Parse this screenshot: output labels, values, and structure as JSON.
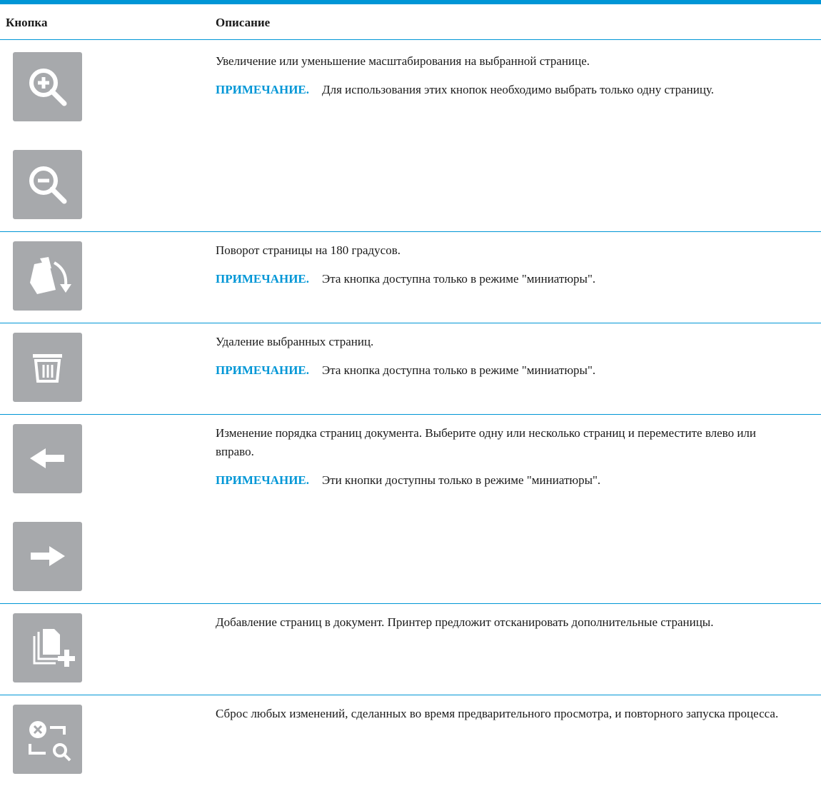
{
  "header": {
    "col_button": "Кнопка",
    "col_description": "Описание"
  },
  "colors": {
    "accent": "#0096d6",
    "button_bg": "#a7a9ac"
  },
  "rows": [
    {
      "icons": [
        "zoom-in-icon",
        "zoom-out-icon"
      ],
      "text": "Увеличение или уменьшение масштабирования на выбранной странице.",
      "note_label": "ПРИМЕЧАНИЕ.",
      "note": "Для использования этих кнопок необходимо выбрать только одну страницу."
    },
    {
      "icons": [
        "rotate-page-icon"
      ],
      "text": "Поворот страницы на 180 градусов.",
      "note_label": "ПРИМЕЧАНИЕ.",
      "note": "Эта кнопка доступна только в режиме \"миниатюры\"."
    },
    {
      "icons": [
        "trash-icon"
      ],
      "text": "Удаление выбранных страниц.",
      "note_label": "ПРИМЕЧАНИЕ.",
      "note": "Эта кнопка доступна только в режиме \"миниатюры\"."
    },
    {
      "icons": [
        "arrow-left-icon",
        "arrow-right-icon"
      ],
      "text": "Изменение порядка страниц документа. Выберите одну или несколько страниц и переместите влево или вправо.",
      "note_label": "ПРИМЕЧАНИЕ.",
      "note": "Эти кнопки доступны только в режиме \"миниатюры\"."
    },
    {
      "icons": [
        "add-pages-icon"
      ],
      "text": "Добавление страниц в документ. Принтер предложит отсканировать дополнительные страницы."
    },
    {
      "icons": [
        "reset-preview-icon"
      ],
      "text": "Сброс любых изменений, сделанных во время предварительного просмотра, и повторного запуска процесса."
    }
  ]
}
